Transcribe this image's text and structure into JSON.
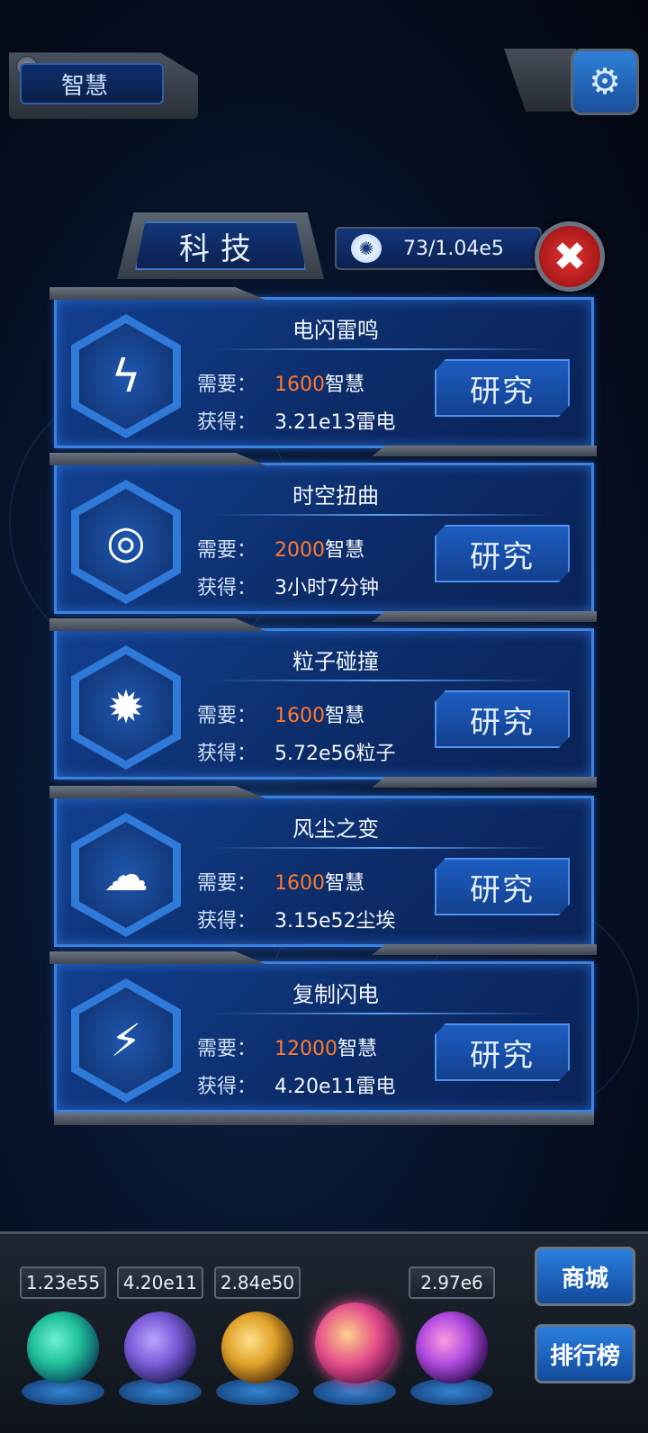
{
  "header": {
    "tab_label": "智慧",
    "settings_icon": "gear-icon"
  },
  "panel": {
    "title": "科技",
    "brain_counter": "73/1.04e5",
    "brain_icon": "brain-icon",
    "close_icon": "close-icon"
  },
  "labels": {
    "require": "需要：",
    "obtain": "获得："
  },
  "cards": [
    {
      "title": "电闪雷鸣",
      "req_num": "1600",
      "req_unit": "智慧",
      "gain": "3.21e13雷电",
      "button": "研究",
      "icon": "lightning-icon"
    },
    {
      "title": "时空扭曲",
      "req_num": "2000",
      "req_unit": "智慧",
      "gain": "3小时7分钟",
      "button": "研究",
      "icon": "vortex-icon"
    },
    {
      "title": "粒子碰撞",
      "req_num": "1600",
      "req_unit": "智慧",
      "gain": "5.72e56粒子",
      "button": "研究",
      "icon": "particle-collision-icon"
    },
    {
      "title": "风尘之变",
      "req_num": "1600",
      "req_unit": "智慧",
      "gain": "3.15e52尘埃",
      "button": "研究",
      "icon": "dust-storm-icon"
    },
    {
      "title": "复制闪电",
      "req_num": "12000",
      "req_unit": "智慧",
      "gain": "4.20e11雷电",
      "button": "研究",
      "icon": "copy-lightning-icon"
    }
  ],
  "resources": [
    {
      "value": "1.23e55",
      "icon": "particle-orb-icon",
      "color": "#1fbf9a"
    },
    {
      "value": "4.20e11",
      "icon": "lightning-orb-icon",
      "color": "#7a5ad8"
    },
    {
      "value": "2.84e50",
      "icon": "dust-orb-icon",
      "color": "#e0a22a"
    },
    {
      "value": "",
      "icon": "brain-orb-icon",
      "color": "#e24a8a"
    },
    {
      "value": "2.97e6",
      "icon": "vortex-orb-icon",
      "color": "#b04ae0"
    }
  ],
  "side_buttons": {
    "shop": "商城",
    "ranking": "排行榜"
  },
  "colors": {
    "accent": "#3b82e0",
    "require_number": "#ff7a2e",
    "close_red": "#e53434"
  }
}
